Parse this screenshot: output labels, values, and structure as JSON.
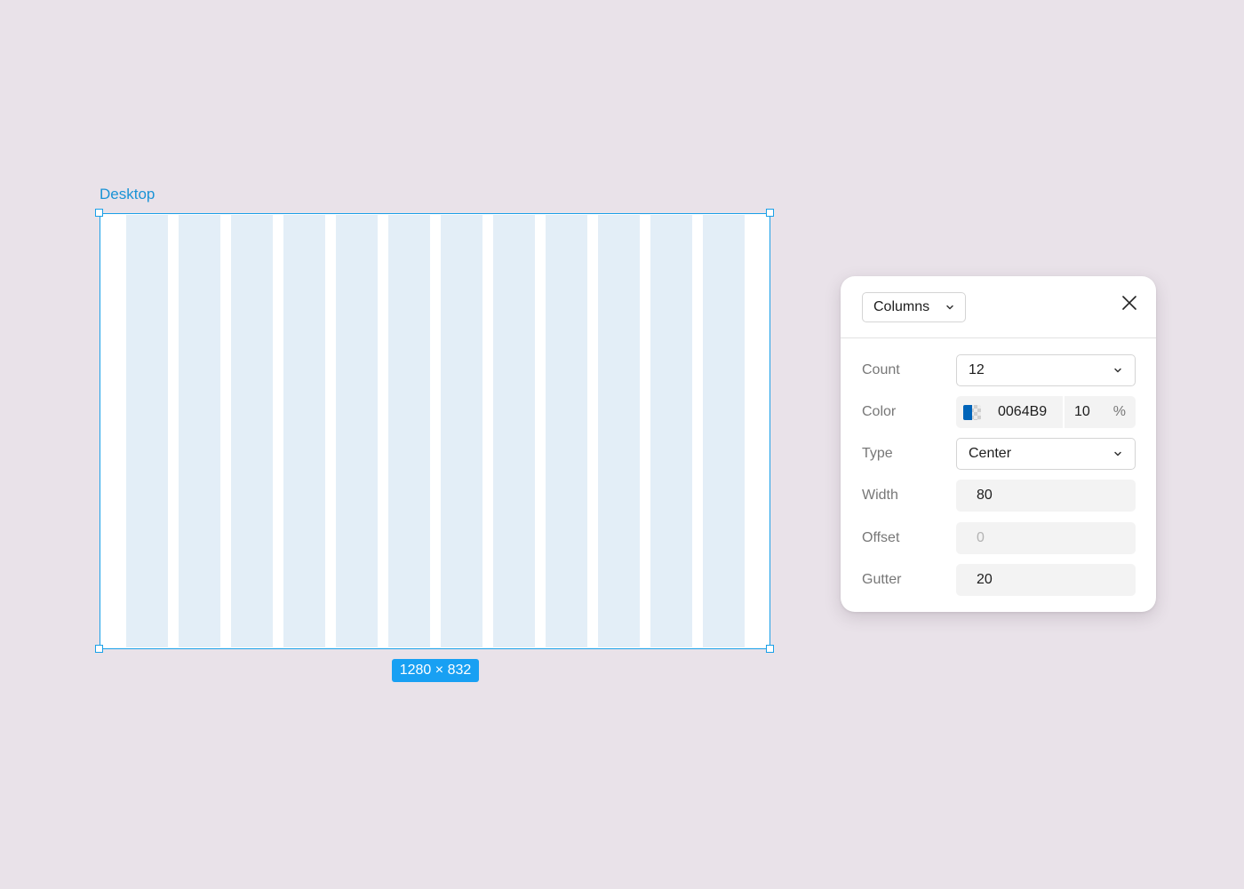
{
  "canvas": {
    "background": "#e9e2e9",
    "frame": {
      "name": "Desktop",
      "size_label": "1280 × 832",
      "selection_color": "#1aa0e8",
      "column_color": "#e3eef7",
      "column_count": 12
    }
  },
  "panel": {
    "grid_type": {
      "label": "Columns",
      "icon": "chevron-down-icon"
    },
    "close_icon": "close-icon",
    "fields": {
      "count": {
        "label": "Count",
        "value": "12",
        "icon": "chevron-down-icon"
      },
      "color": {
        "label": "Color",
        "hex": "0064B9",
        "opacity": "10",
        "unit": "%",
        "swatch": "#0064B9"
      },
      "type": {
        "label": "Type",
        "value": "Center",
        "icon": "chevron-down-icon"
      },
      "width": {
        "label": "Width",
        "value": "80"
      },
      "offset": {
        "label": "Offset",
        "placeholder": "0"
      },
      "gutter": {
        "label": "Gutter",
        "value": "20"
      }
    }
  }
}
